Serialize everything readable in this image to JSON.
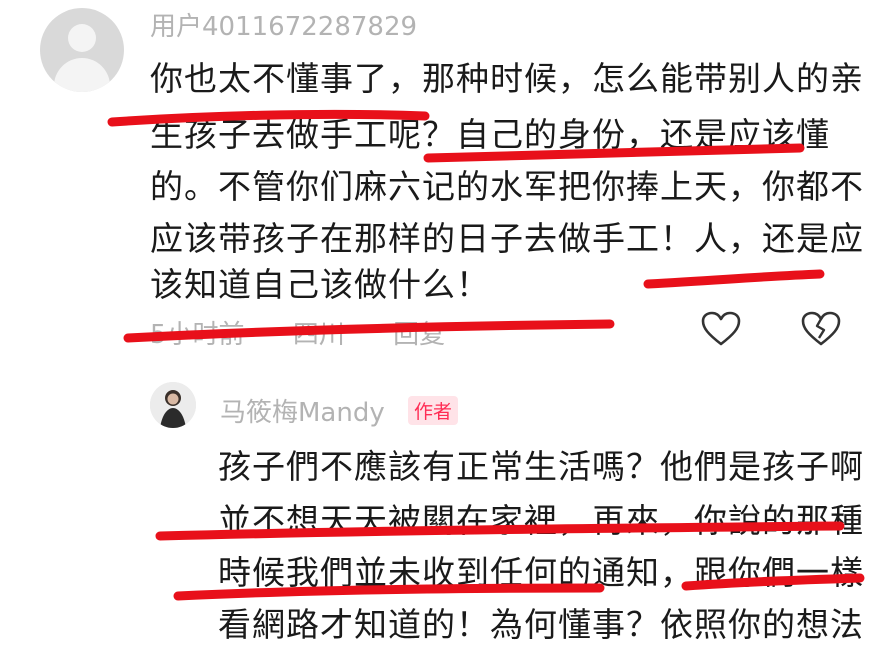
{
  "comment": {
    "username": "用户4011672287829",
    "lines": [
      "你也太不懂事了，那种时候，怎么能带别人的亲",
      "生孩子去做手工呢？自己的身份，还是应该懂",
      "的。不管你们麻六记的水军把你捧上天，你都不",
      "应该带孩子在那样的日子去做手工！人，还是应",
      "该知道自己该做什么！"
    ],
    "time": "5小时前",
    "location": "四川",
    "reply_label": "回复",
    "like_icon": "heart-outline-icon",
    "dislike_icon": "broken-heart-icon"
  },
  "reply": {
    "username": "马筱梅Mandy",
    "badge": "作者",
    "lines": [
      "孩子們不應該有正常生活嗎？他們是孩子啊",
      "並不想天天被關在家裡，再來，你說的那種",
      "時候我們並未收到任何的通知，跟你們一樣",
      "看網路才知道的！為何懂事？依照你的想法"
    ]
  },
  "colors": {
    "annotation_red": "#e8101a",
    "text": "#1a1a1a",
    "meta_gray": "#b3b3b3",
    "author_badge": "#ff2d55"
  }
}
